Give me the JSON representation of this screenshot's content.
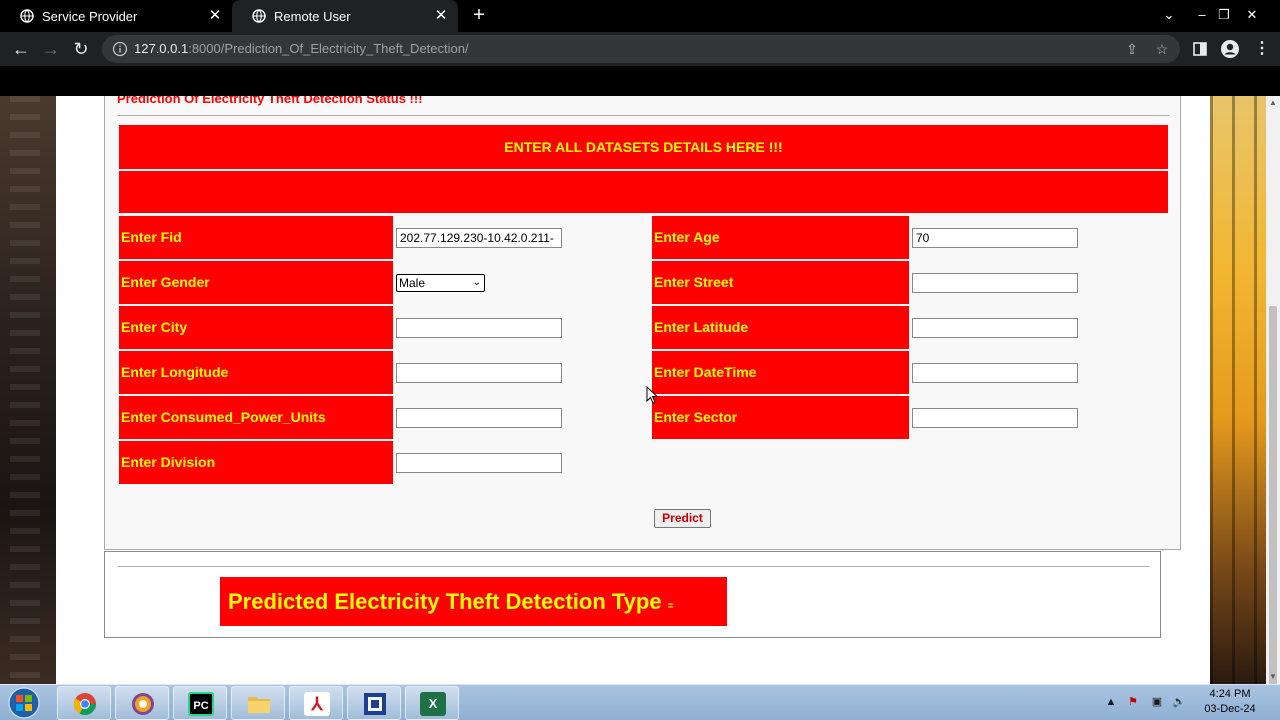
{
  "browser": {
    "tabs": [
      {
        "label": "Service Provider",
        "active": false
      },
      {
        "label": "Remote User",
        "active": true
      }
    ],
    "url_host": "127.0.0.1",
    "url_rest": ":8000/Prediction_Of_Electricity_Theft_Detection/"
  },
  "page": {
    "status_title": "Prediction Of Electricity Theft Detection Status !!!",
    "header": "ENTER ALL DATASETS DETAILS HERE !!!",
    "form": {
      "fid_label": "Enter Fid",
      "fid_value": "202.77.129.230-10.42.0.211-",
      "age_label": "Enter Age",
      "age_value": "70",
      "gender_label": "Enter Gender",
      "gender_value": "Male",
      "street_label": "Enter Street",
      "street_value": "",
      "city_label": "Enter City",
      "city_value": "",
      "latitude_label": "Enter Latitude",
      "latitude_value": "",
      "longitude_label": "Enter Longitude",
      "longitude_value": "",
      "datetime_label": "Enter DateTime",
      "datetime_value": "",
      "consumed_label": "Enter Consumed_Power_Units",
      "consumed_value": "",
      "sector_label": "Enter Sector",
      "sector_value": "",
      "division_label": "Enter Division",
      "division_value": ""
    },
    "predict_button": "Predict",
    "result_label": "Predicted Electricity Theft Detection Type",
    "result_value": "="
  },
  "taskbar": {
    "apps": [
      "chrome",
      "tor-browser",
      "pycharm",
      "file-explorer",
      "acrobat",
      "app-window",
      "excel"
    ],
    "time": "4:24 PM",
    "date": "03-Dec-24"
  },
  "colors": {
    "accent_red": "#ff0000",
    "label_yellow": "#ffff00"
  }
}
